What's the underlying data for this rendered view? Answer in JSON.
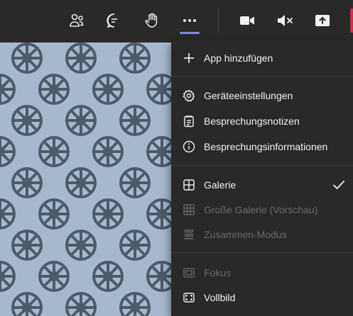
{
  "toolbar": {
    "buttons": [
      {
        "icon": "people-icon"
      },
      {
        "icon": "chat-icon"
      },
      {
        "icon": "raise-hand-icon"
      },
      {
        "icon": "more-options-icon",
        "active": true
      },
      {
        "icon": "camera-icon"
      },
      {
        "icon": "mic-muted-icon"
      },
      {
        "icon": "share-screen-icon"
      }
    ],
    "active_underline_color": "#7f85f5",
    "share_accent_color": "#c4314b"
  },
  "menu": {
    "items": [
      {
        "label": "App hinzufügen",
        "icon": "plus-icon",
        "enabled": true,
        "checked": false
      },
      {
        "label": "Geräteeinstellungen",
        "icon": "gear-icon",
        "enabled": true,
        "checked": false
      },
      {
        "label": "Besprechungsnotizen",
        "icon": "notes-icon",
        "enabled": true,
        "checked": false
      },
      {
        "label": "Besprechungsinformationen",
        "icon": "info-icon",
        "enabled": true,
        "checked": false
      },
      {
        "label": "Galerie",
        "icon": "gallery-icon",
        "enabled": true,
        "checked": true
      },
      {
        "label": "Große Galerie (Vorschau)",
        "icon": "large-gallery-icon",
        "enabled": false,
        "checked": false
      },
      {
        "label": "Zusammen-Modus",
        "icon": "together-mode-icon",
        "enabled": false,
        "checked": false
      },
      {
        "label": "Fokus",
        "icon": "focus-icon",
        "enabled": false,
        "checked": false
      },
      {
        "label": "Vollbild",
        "icon": "fullscreen-icon",
        "enabled": true,
        "checked": false
      }
    ]
  },
  "video": {
    "background_color": "#9fb1c6",
    "pattern": "wheel-pattern"
  }
}
